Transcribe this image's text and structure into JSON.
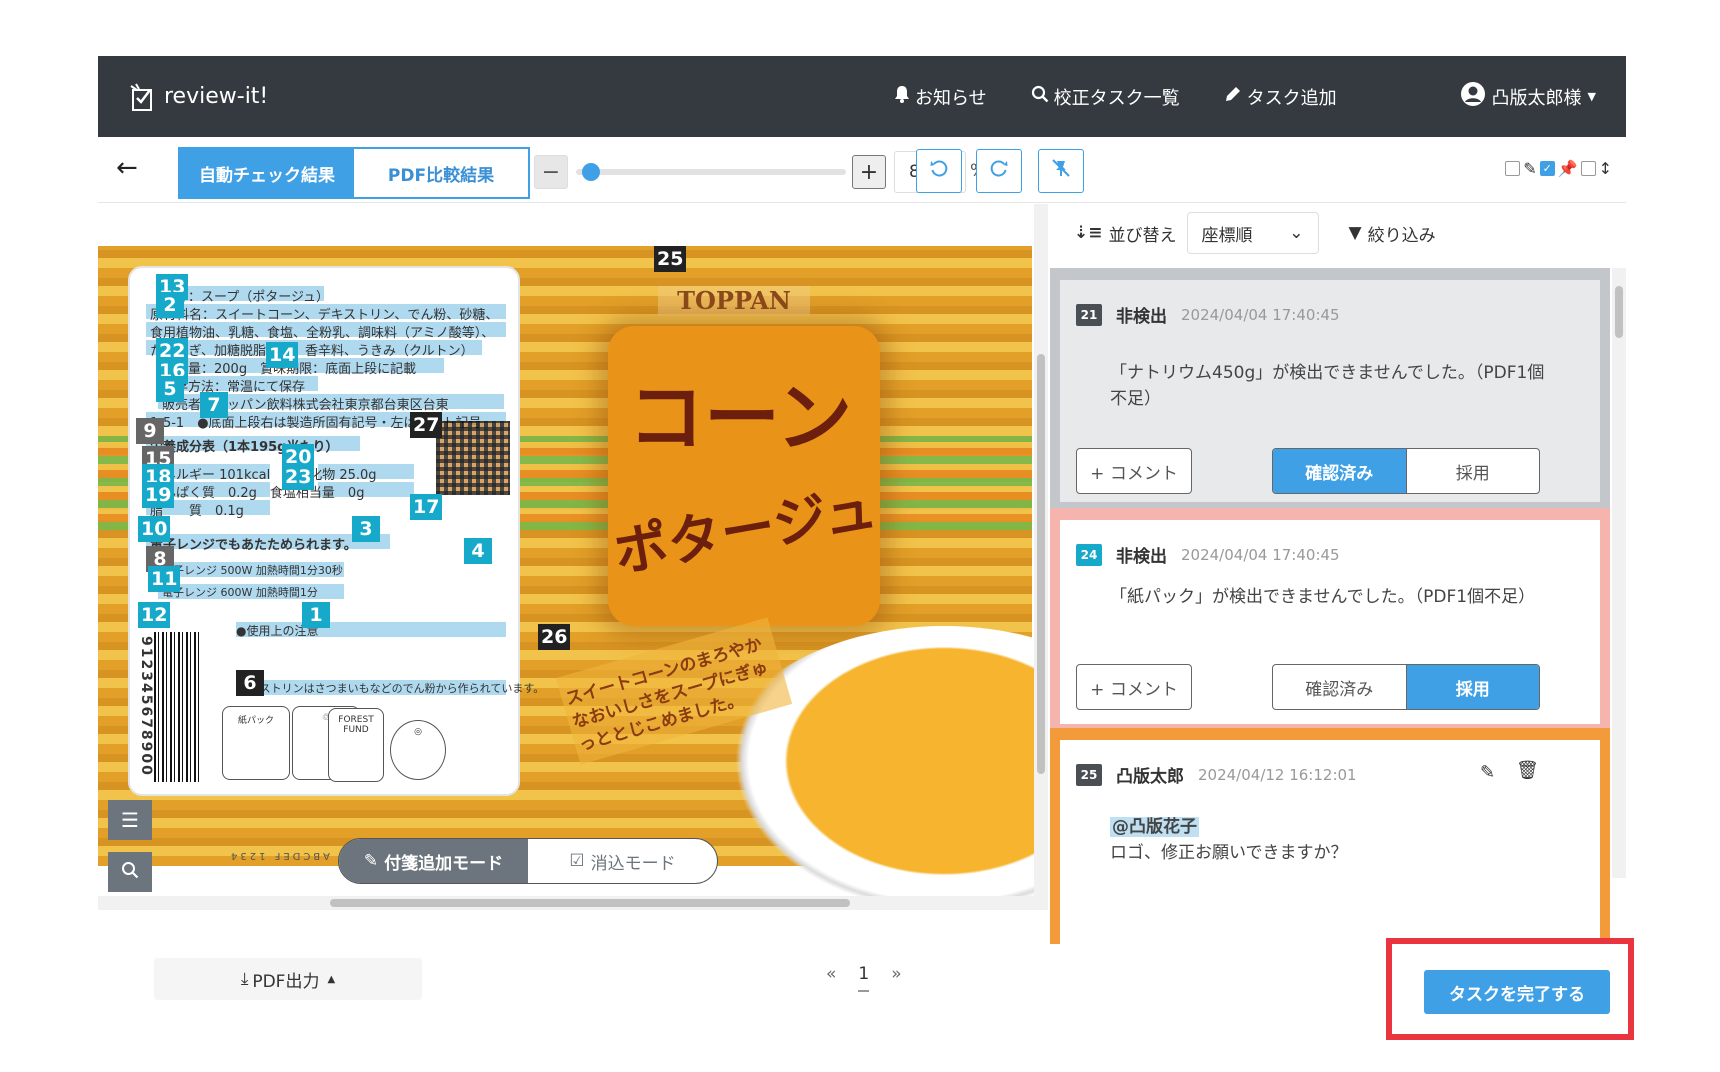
{
  "nav": {
    "brand": "review-it!",
    "notifications": "お知らせ",
    "task_list": "校正タスク一覧",
    "add_task": "タスク追加",
    "user": "凸版太郎様"
  },
  "toolbar": {
    "tab_auto": "自動チェック結果",
    "tab_pdf": "PDF比較結果",
    "zoom_value": "80",
    "zoom_unit": "%",
    "zoom_minus": "−",
    "zoom_plus": "+"
  },
  "viewer": {
    "logo": "TOPPAN",
    "title_line1": "コーン",
    "title_line2": "ポタージュ",
    "slogan": "スイートコーンのまろやかなおいしさをスープにぎゅっととじこめました。",
    "label_lines": [
      "名称：スープ（ポタージュ）",
      "原材料名：スイートコーン、デキストリン、でん粉、砂糖、",
      "食用植物油、乳糖、食塩、全粉乳、調味料（アミノ酸等）、",
      "たまねぎ、加糖脱脂粉乳、香辛料、うきみ（クルトン）",
      "内容量：200g　賞味期限：底面上段に記載",
      "保存方法：常温にて保存",
      "販売者：トッパン飲料株式会社東京都台東区台東",
      "1-5-1　●底面上段右は製造所固有記号・左はロット記号",
      "栄養成分表（1本195g当たり）",
      "エネルギー 101kcal　炭水化物 25.0g",
      "たんぱく質　0.2g　食塩相当量　0g",
      "脂　　質　0.1g",
      "電子レンジでもあたためられます。",
      "電子レンジ 500W 加熱時間1分30秒",
      "電子レンジ 600W 加熱時間1分",
      "●使用上の注意",
      "デキストリンはさつまいもなどのでん粉から作られています。"
    ],
    "barcode_number": "912345678900",
    "bottom_text": "ABCDEF 1234",
    "tags": [
      "13",
      "2",
      "22",
      "14",
      "16",
      "5",
      "7",
      "9",
      "27",
      "15",
      "20",
      "18",
      "23",
      "19",
      "17",
      "10",
      "3",
      "8",
      "4",
      "11",
      "12",
      "1",
      "6",
      "25",
      "26"
    ],
    "mode_add": "付箋追加モード",
    "mode_erase": "消込モード"
  },
  "panel": {
    "sort_label": "並び替え",
    "sort_value": "座標順",
    "filter_label": "絞り込み",
    "cards": [
      {
        "num": "21",
        "type": "非検出",
        "date": "2024/04/04 17:40:45",
        "message": "「ナトリウム450g」が検出できませんでした。（PDF1個不足）",
        "comment_btn": "+ コメント",
        "confirm": "確認済み",
        "adopt": "採用"
      },
      {
        "num": "24",
        "type": "非検出",
        "date": "2024/04/04 17:40:45",
        "message": "「紙パック」が検出できませんでした。（PDF1個不足）",
        "comment_btn": "+ コメント",
        "confirm": "確認済み",
        "adopt": "採用"
      },
      {
        "num": "25",
        "author": "凸版太郎",
        "date": "2024/04/12 16:12:01",
        "mention": "@凸版花子",
        "message": "ロゴ、修正お願いできますか？"
      }
    ]
  },
  "footer": {
    "pdf_export": "PDF出力",
    "page_prev": "«",
    "page_current": "1",
    "page_next": "»",
    "complete_task": "タスクを完了する"
  },
  "colors": {
    "accent": "#3fa0e6",
    "navbar": "#343a40",
    "tag": "#16a9c9",
    "highlight_box": "#e8353f"
  }
}
